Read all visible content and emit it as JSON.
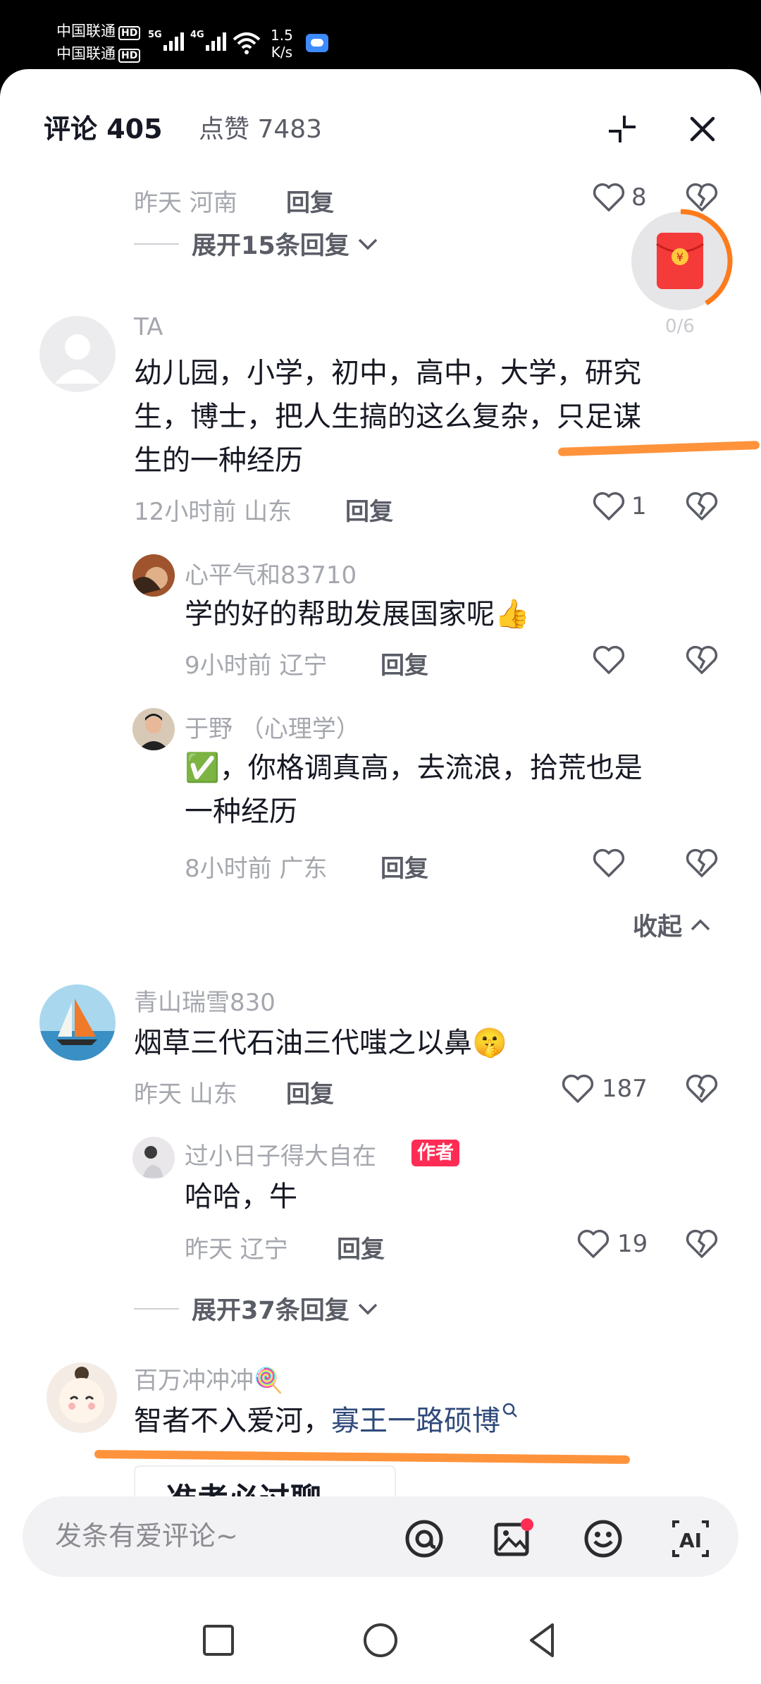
{
  "status_bar": {
    "carrier1": "中国联通",
    "carrier2": "中国联通",
    "hd": "HD",
    "gen1": "5G",
    "gen2": "4G",
    "net_speed_value": "1.5",
    "net_speed_unit": "K/s"
  },
  "header": {
    "title": "评论 405",
    "likes": "点赞 7483"
  },
  "prev_comment": {
    "time_loc": "昨天 河南",
    "reply": "回复",
    "likes": "8",
    "expand": "展开15条回复"
  },
  "redpacket": {
    "progress": "0/6"
  },
  "comments": [
    {
      "name": "TA",
      "text_lines": [
        "幼儿园，小学，初中，高中，大学，研究",
        "生，博士，把人生搞的这么复杂，只足谋",
        "生的一种经历"
      ],
      "time_loc": "12小时前 山东",
      "reply": "回复",
      "likes": "1",
      "replies": [
        {
          "name": "心平气和83710",
          "text": "学的好的帮助发展国家呢👍",
          "time_loc": "9小时前 辽宁",
          "reply": "回复"
        },
        {
          "name": "于野 （心理学）",
          "text_lines": [
            "✅，你格调真高，去流浪，拾荒也是",
            "一种经历"
          ],
          "time_loc": "8小时前 广东",
          "reply": "回复"
        }
      ],
      "collapse": "收起"
    },
    {
      "name": "青山瑞雪830",
      "text": "烟草三代石油三代嗤之以鼻🤫",
      "time_loc": "昨天 山东",
      "reply": "回复",
      "likes": "187",
      "replies": [
        {
          "name": "过小日子得大自在",
          "badge": "作者",
          "text": "哈哈，牛",
          "time_loc": "昨天 辽宁",
          "reply": "回复",
          "likes": "19"
        }
      ],
      "expand": "展开37条回复"
    },
    {
      "name": "百万冲冲冲🍭",
      "text_plain": "智者不入爱河，",
      "text_link": "寡王一路硕博",
      "peek": "准考必过聊"
    }
  ],
  "composer": {
    "placeholder": "发条有爱评论~"
  },
  "colors": {
    "accent": "#fe2c55",
    "underline": "#ff8a2b",
    "link": "#2f4a7a"
  },
  "icons": [
    "shrink-icon",
    "close-icon",
    "heart-icon",
    "broken-heart-icon",
    "at-icon",
    "image-icon",
    "emoji-icon",
    "ai-icon",
    "redpacket-icon"
  ]
}
